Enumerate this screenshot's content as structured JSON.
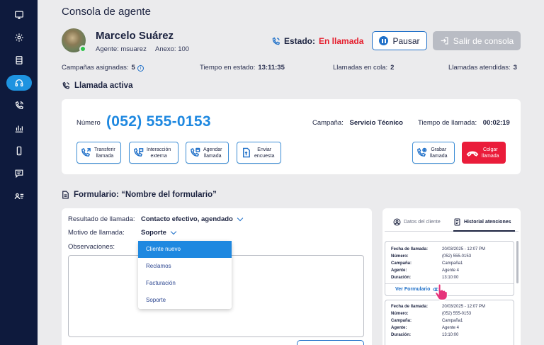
{
  "page_title": "Consola de agente",
  "agent": {
    "name": "Marcelo Suárez",
    "agent_line": "Agente: msuarez",
    "anexo_line": "Anexo: 100"
  },
  "status": {
    "label": "Estado:",
    "value": "En llamada",
    "pause_label": "Pausar",
    "exit_label": "Salir de consola"
  },
  "stats": {
    "campaigns_label": "Campañas asignadas:",
    "campaigns_value": "5",
    "time_label": "Tiempo en estado:",
    "time_value": "13:11:35",
    "queue_label": "Llamadas en cola:",
    "queue_value": "2",
    "attended_label": "Llamadas atendidas:",
    "attended_value": "3"
  },
  "active_call": {
    "section_title": "Llamada activa",
    "number_label": "Número",
    "number_value": "(052) 555-0153",
    "campaign_label": "Campaña:",
    "campaign_value": "Servicio Técnico",
    "duration_label": "Tiempo de llamada:",
    "duration_value": "00:02:19",
    "actions": {
      "transfer": [
        "Transferir",
        "llamada"
      ],
      "interaction": [
        "Interacción",
        "externa"
      ],
      "schedule": [
        "Agendar",
        "llamada"
      ],
      "survey": [
        "Enviar",
        "encuesta"
      ],
      "record": [
        "Grabar",
        "llamada"
      ],
      "hangup": [
        "Colgar",
        "llamada"
      ]
    }
  },
  "form": {
    "section_title": "Formulario: “Nombre del formulario”",
    "result_label": "Resultado de llamada:",
    "result_value": "Contacto efectivo, agendado",
    "reason_label": "Motivo de llamada:",
    "reason_value": "Soporte",
    "observations_label": "Observaciones:",
    "dropdown_options": [
      "Cliente nuevo",
      "Reclamos",
      "Facturación",
      "Soporte"
    ]
  },
  "side_panel": {
    "tab_client": "Datos del cliente",
    "tab_history": "Historial atenciones",
    "history_keys": {
      "date": "Fecha de llamada:",
      "number": "Número:",
      "campaign": "Campaña:",
      "agent": "Agente:",
      "duration": "Duración:"
    },
    "history": [
      {
        "date": "20/03/2025 - 12:07 PM",
        "number": "(052) 555-0153",
        "campaign": "Campaña1",
        "agent": "Agente 4",
        "duration": "13:10:00",
        "link": "Ver Formulario"
      },
      {
        "date": "20/03/2025 - 12:07 PM",
        "number": "(052) 555-0153",
        "campaign": "Campaña1",
        "agent": "Agente 4",
        "duration": "13:10:00"
      }
    ]
  },
  "colors": {
    "sidebar_bg": "#0e1a3d",
    "accent": "#1e88e0",
    "danger": "#ea1c3a",
    "status_red": "#e5202f"
  },
  "sidebar_icons": [
    "monitor-icon",
    "gear-icon",
    "database-icon",
    "headset-icon",
    "phone-signal-icon",
    "bar-chart-icon",
    "mobile-icon",
    "chat-icon",
    "contacts-icon"
  ]
}
